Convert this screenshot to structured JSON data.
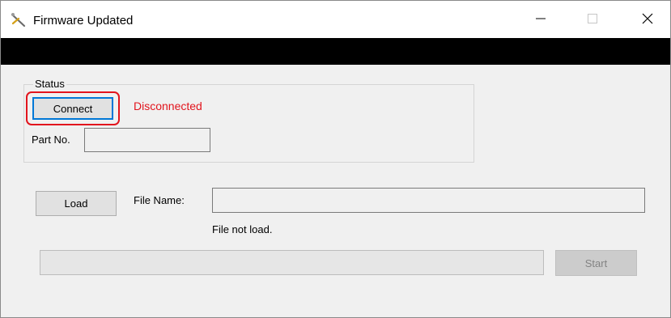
{
  "window": {
    "title": "Firmware Updated",
    "icon": "wrench-screwdriver-icon",
    "controls": {
      "minimize": "minimize-icon",
      "maximize": "maximize-icon",
      "close": "close-icon"
    }
  },
  "status_group": {
    "label": "Status",
    "connect_label": "Connect",
    "connection_status": "Disconnected",
    "part_label": "Part No.",
    "part_value": ""
  },
  "file": {
    "load_label": "Load",
    "name_label": "File Name:",
    "name_value": "",
    "status": "File not load."
  },
  "progress": {
    "value": 0
  },
  "start_label": "Start",
  "colors": {
    "error": "#e2141d",
    "focus": "#0078d7",
    "window_bg": "#f0f0f0",
    "disabled_text": "#838383"
  }
}
